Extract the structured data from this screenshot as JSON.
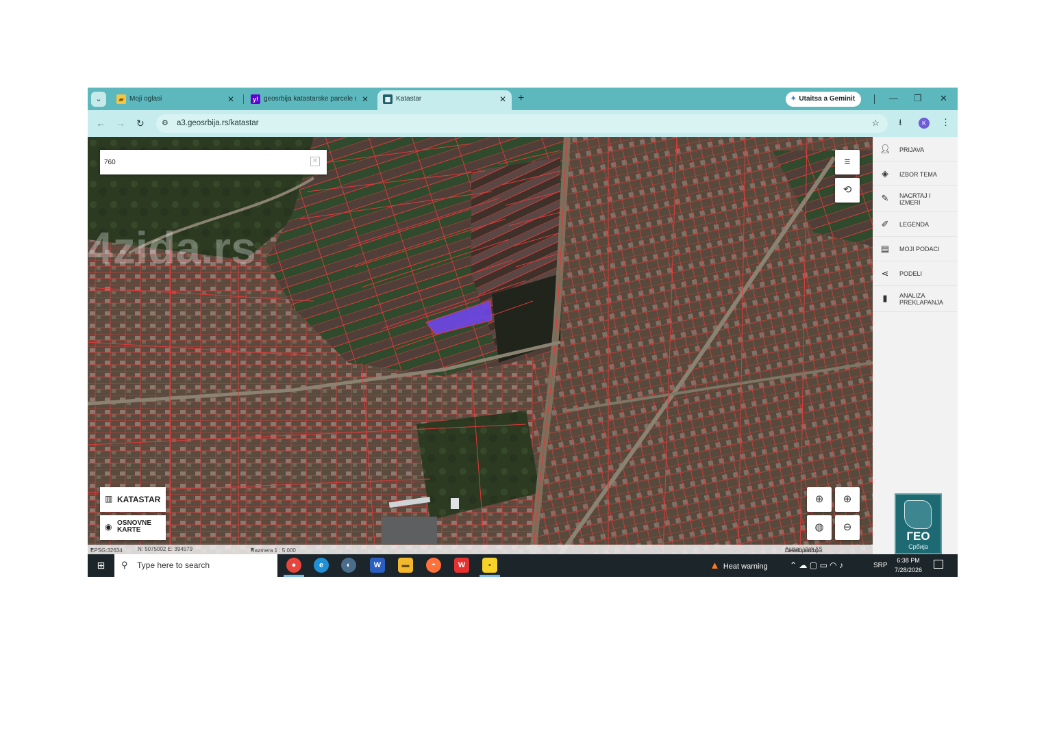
{
  "browser": {
    "tabs": [
      {
        "label": "Moji oglasi",
        "icon": "folder-icon"
      },
      {
        "label": "geosrbija katastarske parcele m",
        "icon": "yahoo-icon"
      },
      {
        "label": "Katastar",
        "icon": "geosrbija-icon"
      }
    ],
    "close_glyph": "✕",
    "newtab_glyph": "+",
    "gemini_label": "Utaitsa a Geminit",
    "url": "a3.geosrbija.rs/katastar",
    "profile_initial": "K",
    "window_controls": {
      "minimize": "—",
      "maximize": "❐",
      "close": "✕"
    }
  },
  "map": {
    "search_value": "760",
    "layer_buttons": {
      "katastar": "KATASTAR",
      "osnovne_line1": "OSNOVNE",
      "osnovne_line2": "KARTE"
    },
    "highlight_color": "#6b47e8",
    "parcel_line_color": "#e23a3a",
    "watermark": "4zida.rs"
  },
  "statusbar": {
    "epsg": "EPSG:32634",
    "coords": "N: 5075002 E: 394579",
    "scale": "Razmera 1 : 5 000",
    "developed_prefix": "Developed by",
    "developer": "Asplan Viak AS"
  },
  "sidebar": {
    "items": [
      {
        "label": "PRIJAVA",
        "icon": "user-icon"
      },
      {
        "label": "IZBOR TEMA",
        "icon": "layers-icon"
      },
      {
        "label": "NACRTAJ I IZMERI",
        "icon": "pencil-icon"
      },
      {
        "label": "LEGENDA",
        "icon": "brush-icon"
      },
      {
        "label": "MOJI PODACI",
        "icon": "briefcase-icon"
      },
      {
        "label": "PODELI",
        "icon": "share-icon"
      },
      {
        "label": "ANALIZA PREKLAPANJA",
        "icon": "clipboard-icon"
      }
    ],
    "logo_text": "ГЕО",
    "logo_sub": "Србија"
  },
  "taskbar": {
    "search_placeholder": "Type here to search",
    "heat_warning": "Heat warning",
    "lang": "SRP",
    "time": "6:38 PM",
    "date": "7/28/2026"
  }
}
